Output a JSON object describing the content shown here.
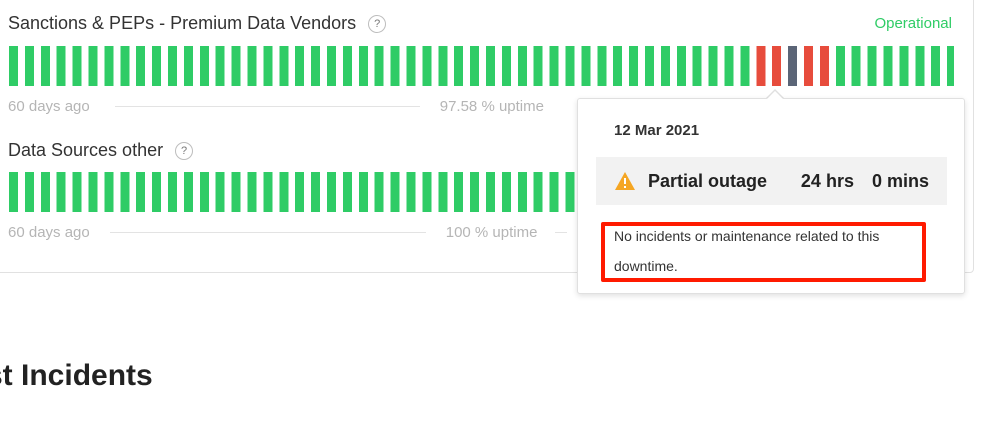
{
  "components": [
    {
      "name": "Sanctions & PEPs - Premium Data Vendors",
      "help": "?",
      "status": "Operational",
      "status_color": "#2fcc66",
      "left_label": "60 days ago",
      "uptime_label": "97.58 % uptime",
      "bar_count": 60,
      "bar_states": [
        "op",
        "op",
        "op",
        "op",
        "op",
        "op",
        "op",
        "op",
        "op",
        "op",
        "op",
        "op",
        "op",
        "op",
        "op",
        "op",
        "op",
        "op",
        "op",
        "op",
        "op",
        "op",
        "op",
        "op",
        "op",
        "op",
        "op",
        "op",
        "op",
        "op",
        "op",
        "op",
        "op",
        "op",
        "op",
        "op",
        "op",
        "op",
        "op",
        "op",
        "op",
        "op",
        "op",
        "op",
        "op",
        "op",
        "op",
        "red",
        "red",
        "sel",
        "red",
        "red",
        "op",
        "op",
        "op",
        "op",
        "op",
        "op",
        "op",
        "op"
      ]
    },
    {
      "name": "Data Sources other",
      "help": "?",
      "left_label": "60 days ago",
      "uptime_label": "100 % uptime",
      "bar_count": 60
    }
  ],
  "colors": {
    "operational": "#2fcc66",
    "outage": "#e74c3c",
    "selected": "#5b6577",
    "warning": "#f5a623"
  },
  "tooltip": {
    "date": "12 Mar 2021",
    "status_icon": "warning-icon",
    "status_label": "Partial outage",
    "hours": "24 hrs",
    "minutes": "0 mins",
    "message": "No incidents or maintenance related to this downtime."
  },
  "section_title": "st Incidents"
}
